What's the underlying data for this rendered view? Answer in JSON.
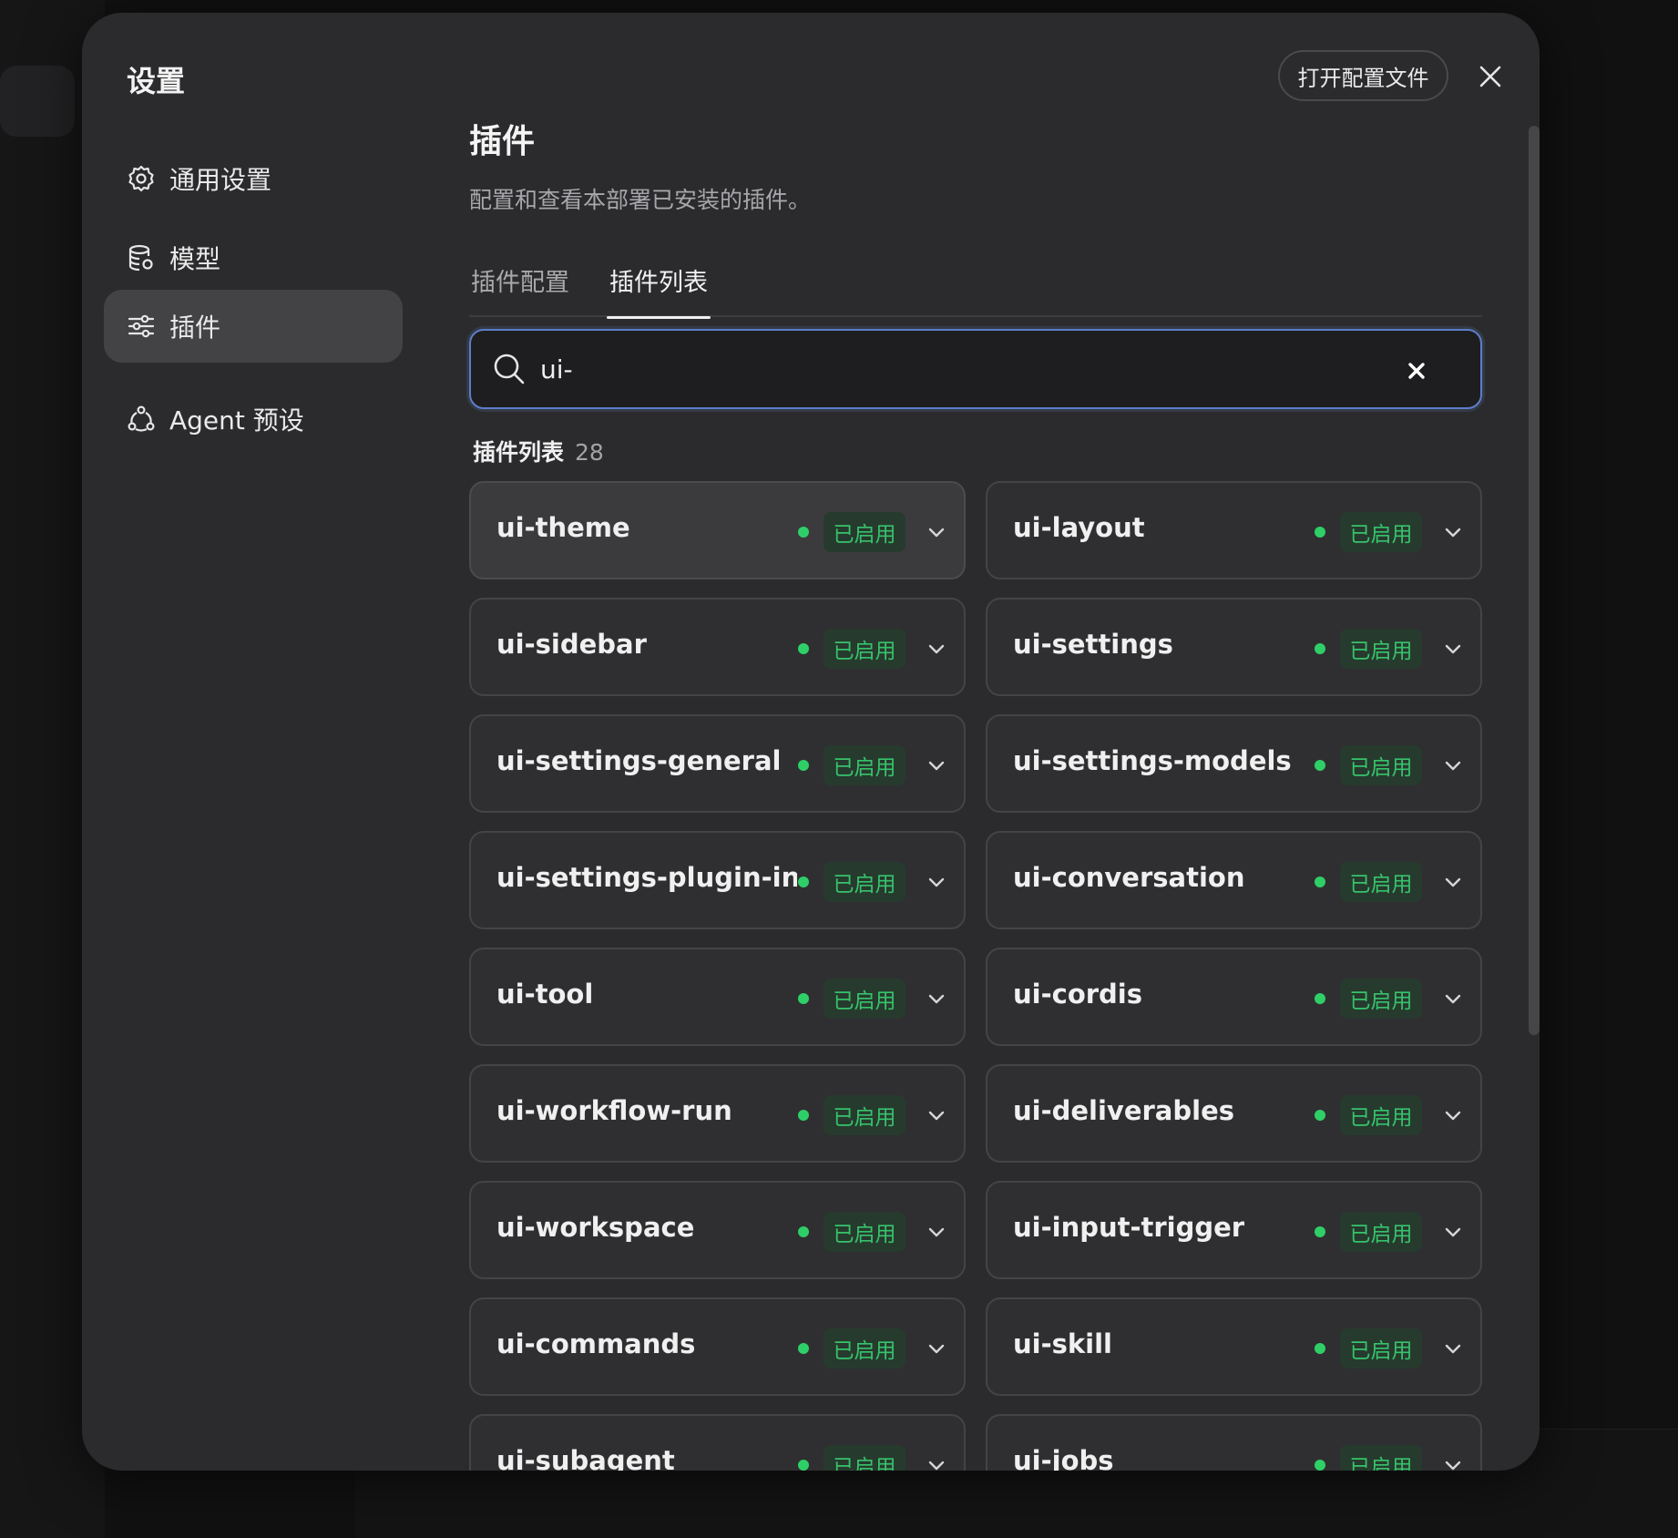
{
  "modal": {
    "title": "设置",
    "open_config_label": "打开配置文件"
  },
  "sidebar": {
    "items": [
      {
        "label": "通用设置",
        "icon": "gear-icon"
      },
      {
        "label": "模型",
        "icon": "database-icon"
      },
      {
        "label": "插件",
        "icon": "sliders-icon",
        "active": true
      },
      {
        "label": "Agent 预设",
        "icon": "agent-network-icon"
      }
    ]
  },
  "content": {
    "title": "插件",
    "description": "配置和查看本部署已安装的插件。",
    "tabs": [
      {
        "label": "插件配置"
      },
      {
        "label": "插件列表",
        "active": true
      }
    ],
    "search": {
      "value": "ui-",
      "placeholder": ""
    },
    "list_title": "插件列表",
    "list_count": "28",
    "status_label": "已启用"
  },
  "plugins": [
    "ui-theme",
    "ui-layout",
    "ui-sidebar",
    "ui-settings",
    "ui-settings-general",
    "ui-settings-models",
    "ui-settings-plugin-in...",
    "ui-conversation",
    "ui-tool",
    "ui-cordis",
    "ui-workflow-run",
    "ui-deliverables",
    "ui-workspace",
    "ui-input-trigger",
    "ui-commands",
    "ui-skill",
    "ui-subagent",
    "ui-jobs"
  ],
  "colors": {
    "modal_bg": "#2b2b2d",
    "accent_focus": "#5d7ec9",
    "status_green": "#2fcf68",
    "status_badge_bg": "#273a2e"
  }
}
